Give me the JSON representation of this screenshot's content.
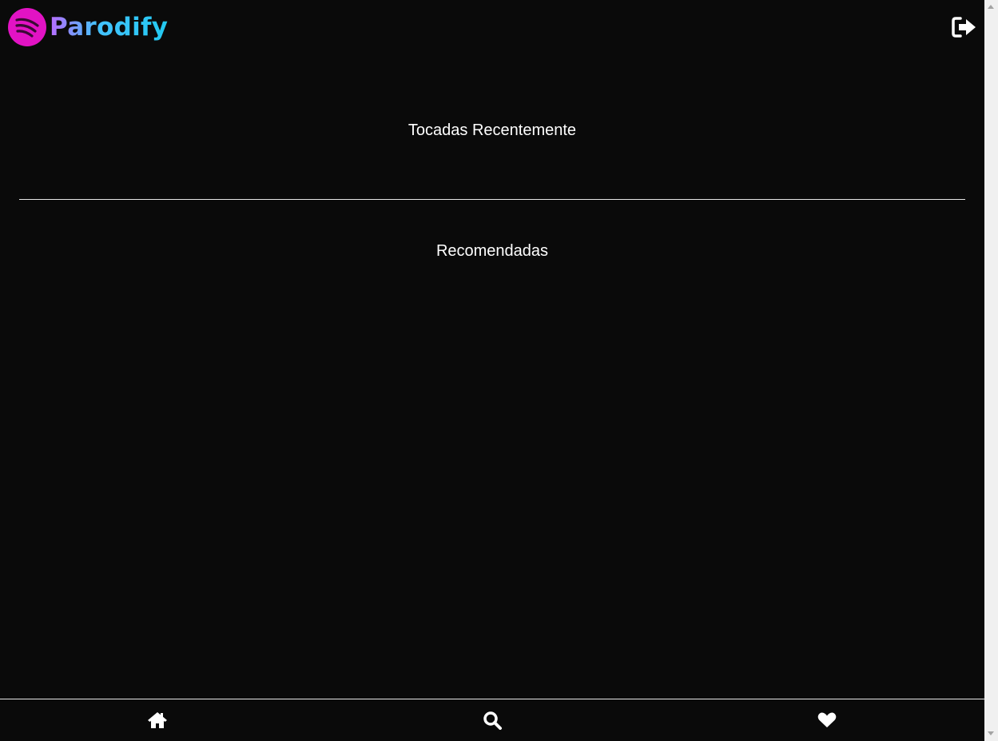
{
  "header": {
    "logo_text": "Parodify",
    "logo_icon": "parodify-logo-icon",
    "logout_icon": "sign-out-icon"
  },
  "sections": {
    "recent_title": "Tocadas Recentemente",
    "recommended_title": "Recomendadas"
  },
  "bottom_nav": {
    "items": [
      {
        "icon": "home-icon"
      },
      {
        "icon": "search-icon"
      },
      {
        "icon": "heart-icon"
      }
    ]
  },
  "colors": {
    "background": "#0a0a0a",
    "text": "#ffffff",
    "logo_circle": "#e213c4",
    "logo_text_gradient_start": "#b86bff",
    "logo_text_gradient_end": "#22c9f0",
    "divider": "#e8e8e8"
  }
}
